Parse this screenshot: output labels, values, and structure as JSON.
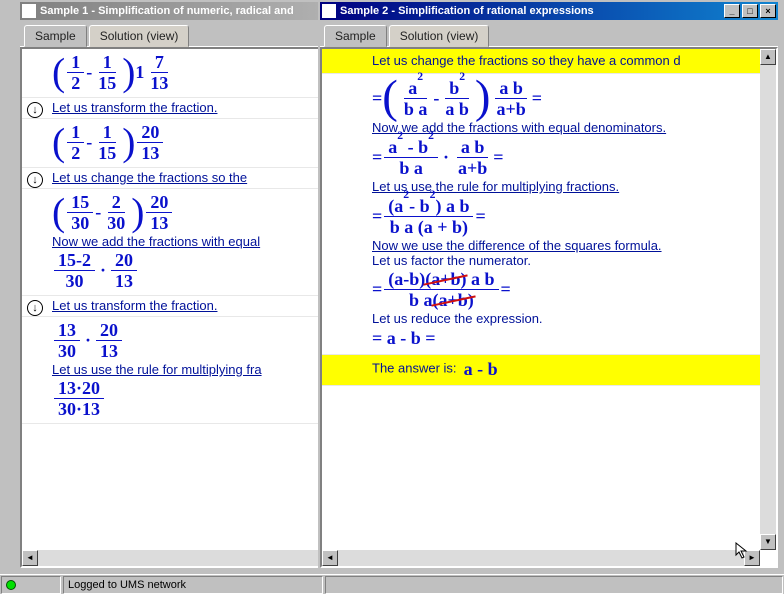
{
  "statusbar": {
    "text": "Logged to UMS network"
  },
  "win1": {
    "title": "Sample 1 - Simplification of numeric, radical and",
    "tabs": {
      "sample": "Sample",
      "solution": "Solution (view)"
    },
    "steps": {
      "s1": "Let us transform the fraction.",
      "s2": "Let us change the fractions so the",
      "s3": "Now we add the fractions with equal",
      "s4": "Let us transform the fraction.",
      "s5": "Let us use the rule for multiplying fra"
    },
    "m": {
      "e1": {
        "a1": "1",
        "a2": "2",
        "b1": "1",
        "b2": "15",
        "c": "1",
        "d1": "7",
        "d2": "13"
      },
      "e2": {
        "a1": "1",
        "a2": "2",
        "b1": "1",
        "b2": "15",
        "d1": "20",
        "d2": "13"
      },
      "e3": {
        "a1": "15",
        "a2": "30",
        "b1": "2",
        "b2": "30",
        "d1": "20",
        "d2": "13"
      },
      "e4": {
        "n": "15-2",
        "d": "30",
        "d1": "20",
        "d2": "13"
      },
      "e5": {
        "a1": "13",
        "a2": "30",
        "d1": "20",
        "d2": "13"
      },
      "e6": {
        "n": "13·20",
        "d": "30·13"
      }
    }
  },
  "win2": {
    "title": "Sample 2 - Simplification of rational expressions",
    "tabs": {
      "sample": "Sample",
      "solution": "Solution (view)"
    },
    "btn": {
      "min": "_",
      "max": "□",
      "close": "×"
    },
    "steps": {
      "s0": "Let us change the fractions so they have a common d",
      "s1": "Now we add the fractions with equal denominators.",
      "s2": "Let us use the rule for multiplying fractions.",
      "s3": "Now we use the difference of the squares formula.",
      "s4": "Let us factor the numerator.",
      "s5": "Let us reduce the expression.",
      "answer_label": "The answer is:",
      "answer_val": "a - b"
    },
    "m": {
      "eq": "=",
      "e1": {
        "a1": "a",
        "a2": "b a",
        "b1": "b",
        "b2": "a b",
        "d1": "a b",
        "d2": "a+b"
      },
      "e2": {
        "n1": "a",
        "n2": "b",
        "d": "b a",
        "d1": "a b",
        "d2": "a+b"
      },
      "e3": {
        "n": "(a",
        "n2": "- b",
        "n3": ") a b",
        "d": "b a (a + b)"
      },
      "e4": {
        "p1": "(a-b)",
        "p2": "(a+b)",
        "p3": "a b",
        "d1": "b a",
        "d2": "(a+b)"
      },
      "e5": "= a - b ="
    }
  }
}
